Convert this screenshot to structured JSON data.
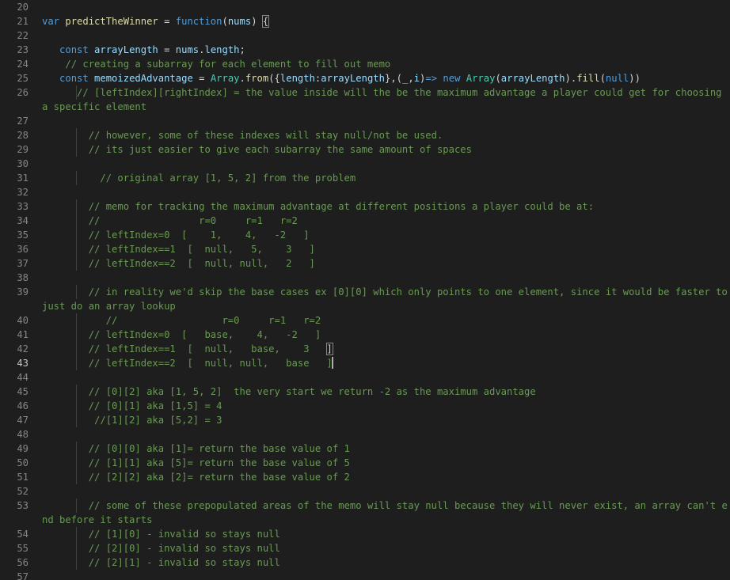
{
  "editor": {
    "lines": [
      {
        "n": "20",
        "t": []
      },
      {
        "n": "21",
        "t": [
          [
            "k",
            "var "
          ],
          [
            "f",
            "predictTheWinner"
          ],
          [
            "p",
            " = "
          ],
          [
            "k",
            "function"
          ],
          [
            "p",
            "("
          ],
          [
            "v",
            "nums"
          ],
          [
            "p",
            ") "
          ],
          [
            "bk",
            "{"
          ]
        ]
      },
      {
        "n": "22",
        "t": []
      },
      {
        "n": "23",
        "t": [
          [
            "p",
            "   "
          ],
          [
            "k",
            "const "
          ],
          [
            "v",
            "arrayLength"
          ],
          [
            "p",
            " = "
          ],
          [
            "v",
            "nums"
          ],
          [
            "p",
            "."
          ],
          [
            "v",
            "length"
          ],
          [
            "p",
            ";"
          ]
        ]
      },
      {
        "n": "24",
        "t": [
          [
            "p",
            "    "
          ],
          [
            "c",
            "// creating a subarray for each element to fill out memo"
          ]
        ]
      },
      {
        "n": "25",
        "t": [
          [
            "p",
            "   "
          ],
          [
            "k",
            "const "
          ],
          [
            "v",
            "memoizedAdvantage"
          ],
          [
            "p",
            " = "
          ],
          [
            "cl",
            "Array"
          ],
          [
            "p",
            "."
          ],
          [
            "f",
            "from"
          ],
          [
            "p",
            "({"
          ],
          [
            "v",
            "length"
          ],
          [
            "p",
            ":"
          ],
          [
            "v",
            "arrayLength"
          ],
          [
            "p",
            "},("
          ],
          [
            "v",
            "_"
          ],
          [
            "p",
            ","
          ],
          [
            "v",
            "i"
          ],
          [
            "p",
            ")"
          ],
          [
            "k",
            "=>"
          ],
          [
            "p",
            " "
          ],
          [
            "k",
            "new "
          ],
          [
            "cl",
            "Array"
          ],
          [
            "p",
            "("
          ],
          [
            "v",
            "arrayLength"
          ],
          [
            "p",
            ")."
          ],
          [
            "f",
            "fill"
          ],
          [
            "p",
            "("
          ],
          [
            "k",
            "null"
          ],
          [
            "p",
            "))"
          ]
        ]
      },
      {
        "n": "26",
        "wrap": true,
        "t": [
          [
            "p",
            "      "
          ],
          [
            "c",
            "// [leftIndex][rightIndex] = the value inside will the be the maximum advantage a player could get for choosing a specific element"
          ]
        ]
      },
      {
        "n": "27",
        "t": []
      },
      {
        "n": "28",
        "t": [
          [
            "p",
            "        "
          ],
          [
            "c",
            "// however, some of these indexes will stay null/not be used."
          ]
        ]
      },
      {
        "n": "29",
        "t": [
          [
            "p",
            "        "
          ],
          [
            "c",
            "// its just easier to give each subarray the same amount of spaces"
          ]
        ]
      },
      {
        "n": "30",
        "t": []
      },
      {
        "n": "31",
        "t": [
          [
            "p",
            "          "
          ],
          [
            "c",
            "// original array [1, 5, 2] from the problem"
          ]
        ]
      },
      {
        "n": "32",
        "t": []
      },
      {
        "n": "33",
        "t": [
          [
            "p",
            "        "
          ],
          [
            "c",
            "// memo for tracking the maximum advantage at different positions a player could be at:"
          ]
        ]
      },
      {
        "n": "34",
        "t": [
          [
            "p",
            "        "
          ],
          [
            "c",
            "//                 r=0     r=1   r=2"
          ]
        ]
      },
      {
        "n": "35",
        "t": [
          [
            "p",
            "        "
          ],
          [
            "c",
            "// leftIndex=0  [    1,    4,   -2   ]"
          ]
        ]
      },
      {
        "n": "36",
        "t": [
          [
            "p",
            "        "
          ],
          [
            "c",
            "// leftIndex==1  [  null,   5,    3   ]"
          ]
        ]
      },
      {
        "n": "37",
        "t": [
          [
            "p",
            "        "
          ],
          [
            "c",
            "// leftIndex==2  [  null, null,   2   ]"
          ]
        ]
      },
      {
        "n": "38",
        "t": []
      },
      {
        "n": "39",
        "wrap": true,
        "t": [
          [
            "p",
            "        "
          ],
          [
            "c",
            "// in reality we'd skip the base cases ex [0][0] which only points to one element, since it would be faster to just do an array lookup"
          ]
        ]
      },
      {
        "n": "40",
        "t": [
          [
            "p",
            "           "
          ],
          [
            "c",
            "//                  r=0     r=1   r=2"
          ]
        ]
      },
      {
        "n": "41",
        "t": [
          [
            "p",
            "        "
          ],
          [
            "c",
            "// leftIndex=0  [   base,    4,   -2   ]"
          ]
        ]
      },
      {
        "n": "42",
        "t": [
          [
            "p",
            "        "
          ],
          [
            "c",
            "// leftIndex==1  [  null,   base,    3   "
          ],
          [
            "bk",
            "]"
          ]
        ]
      },
      {
        "n": "43",
        "active": true,
        "caret": true,
        "t": [
          [
            "p",
            "        "
          ],
          [
            "c",
            "// leftIndex==2  [  null, null,   base   ]"
          ]
        ]
      },
      {
        "n": "44",
        "t": []
      },
      {
        "n": "45",
        "t": [
          [
            "p",
            "        "
          ],
          [
            "c",
            "// [0][2] aka [1, 5, 2]  the very start we return -2 as the maximum advantage"
          ]
        ]
      },
      {
        "n": "46",
        "t": [
          [
            "p",
            "        "
          ],
          [
            "c",
            "// [0][1] aka [1,5] = 4"
          ]
        ]
      },
      {
        "n": "47",
        "t": [
          [
            "p",
            "         "
          ],
          [
            "c",
            "//[1][2] aka [5,2] = 3"
          ]
        ]
      },
      {
        "n": "48",
        "t": []
      },
      {
        "n": "49",
        "t": [
          [
            "p",
            "        "
          ],
          [
            "c",
            "// [0][0] aka [1]= return the base value of 1"
          ]
        ]
      },
      {
        "n": "50",
        "t": [
          [
            "p",
            "        "
          ],
          [
            "c",
            "// [1][1] aka [5]= return the base value of 5"
          ]
        ]
      },
      {
        "n": "51",
        "t": [
          [
            "p",
            "        "
          ],
          [
            "c",
            "// [2][2] aka [2]= return the base value of 2"
          ]
        ]
      },
      {
        "n": "52",
        "t": []
      },
      {
        "n": "53",
        "wrap": true,
        "t": [
          [
            "p",
            "        "
          ],
          [
            "c",
            "// some of these prepopulated areas of the memo will stay null because they will never exist, an array can't end before it starts"
          ]
        ]
      },
      {
        "n": "54",
        "t": [
          [
            "p",
            "        "
          ],
          [
            "c",
            "// [1][0] - invalid so stays null"
          ]
        ]
      },
      {
        "n": "55",
        "t": [
          [
            "p",
            "        "
          ],
          [
            "c",
            "// [2][0] - invalid so stays null"
          ]
        ]
      },
      {
        "n": "56",
        "t": [
          [
            "p",
            "        "
          ],
          [
            "c",
            "// [2][1] - invalid so stays null"
          ]
        ]
      },
      {
        "n": "57",
        "t": []
      }
    ]
  },
  "colors": {
    "background": "#1e1e1e",
    "line_number": "#858585",
    "comment": "#6a9955",
    "keyword": "#569cd6",
    "function": "#dcdcaa",
    "variable": "#9cdcfe",
    "class": "#4ec9b0",
    "punctuation": "#d4d4d4"
  }
}
